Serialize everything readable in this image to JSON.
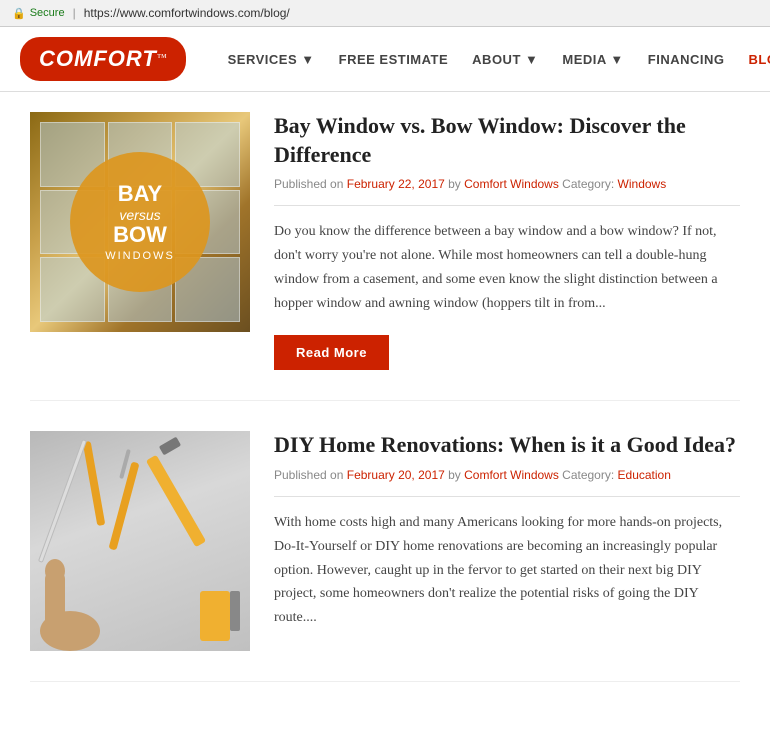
{
  "browser": {
    "secure_text": "Secure",
    "url": "https://www.comfortwindows.com/blog/"
  },
  "navbar": {
    "logo_text": "COMFORT",
    "logo_tm": "™",
    "links": [
      {
        "label": "SERVICES ▼",
        "id": "services"
      },
      {
        "label": "FREE ESTIMATE",
        "id": "free-estimate"
      },
      {
        "label": "ABOUT ▼",
        "id": "about"
      },
      {
        "label": "MEDIA ▼",
        "id": "media"
      },
      {
        "label": "FINANCING",
        "id": "financing"
      },
      {
        "label": "BLOG",
        "id": "blog",
        "active": true
      }
    ]
  },
  "posts": [
    {
      "id": "bay-window",
      "title": "Bay Window vs. Bow Window: Discover the Difference",
      "meta_prefix": "Published on ",
      "date": "February 22, 2017",
      "meta_by": " by ",
      "author": "Comfort Windows",
      "meta_category": " Category: ",
      "category": "Windows",
      "excerpt": "Do you know the difference between a bay window and a bow window? If not, don't worry you're not alone. While most homeowners can tell a double-hung window from a casement, and some even know the slight distinction between a hopper window and awning window (hoppers tilt in from...",
      "read_more": "Read More",
      "image_lines": [
        "BAY",
        "versus",
        "BOW",
        "WINDOWS"
      ]
    },
    {
      "id": "diy-home",
      "title": "DIY Home Renovations: When is it a Good Idea?",
      "meta_prefix": "Published on ",
      "date": "February 20, 2017",
      "meta_by": " by ",
      "author": "Comfort Windows",
      "meta_category": " Category: ",
      "category": "Education",
      "excerpt": "With home costs high and many Americans looking for more hands-on projects, Do-It-Yourself or DIY home renovations are becoming an increasingly popular option. However, caught up in the fervor to get started on their next big DIY project, some homeowners don't realize the potential risks of going the DIY route....",
      "read_more": "Read More"
    }
  ]
}
